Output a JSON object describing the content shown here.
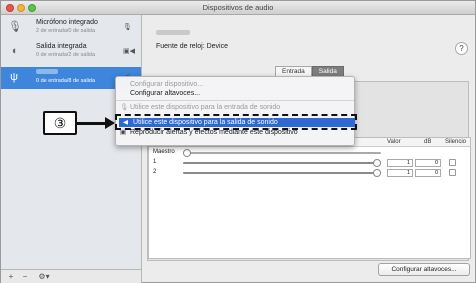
{
  "window": {
    "title": "Dispositivos de audio"
  },
  "sidebar": {
    "devices": [
      {
        "name": "Micrófono integrado",
        "detail": "2 de entrada/0 de salida",
        "icon": "microphone-icon",
        "right_icon": "microphone-small-icon",
        "right_glyph": "🎙",
        "glyph": "🎙"
      },
      {
        "name": "Salida integrada",
        "detail": "0 de entrada/2 de salida",
        "icon": "speaker-icon",
        "right_icon": "speaker-volume-icon",
        "right_glyph": "▣◀",
        "glyph": "◖"
      },
      {
        "name": "",
        "detail": "0 de entrada/8 de salida",
        "icon": "usb-icon",
        "right_icon": "speaker-output-icon",
        "right_glyph": "◀)",
        "glyph": "ψ",
        "selected": true
      }
    ],
    "bottom": {
      "add": "+",
      "remove": "−",
      "settings": "⚙▾"
    }
  },
  "main": {
    "clock_source": "Fuente de reloj: Device",
    "help": "?",
    "tabs": [
      {
        "label": "Entrada",
        "active": false
      },
      {
        "label": "Salida",
        "active": true
      }
    ],
    "table": {
      "headers": {
        "value": "Valor",
        "db": "dB",
        "mute": "Silencio"
      },
      "rows": [
        {
          "label": "Maestro",
          "has_slider": true,
          "has_value": false,
          "fill": 0.0
        },
        {
          "label": "1",
          "has_slider": true,
          "has_value": true,
          "value": "1",
          "db": "0",
          "fill": 1.0
        },
        {
          "label": "2",
          "has_slider": true,
          "has_value": true,
          "value": "1",
          "db": "0",
          "fill": 1.0
        }
      ]
    },
    "configure_speakers_button": "Configurar altavoces..."
  },
  "context_menu": {
    "items": [
      {
        "label": "Configurar dispositivo...",
        "disabled": true,
        "icon": ""
      },
      {
        "label": "Configurar altavoces...",
        "disabled": false,
        "icon": ""
      },
      {
        "label": "Utilice este dispositivo para la entrada de sonido",
        "disabled": true,
        "icon": "🎙"
      },
      {
        "label": "Utilice este dispositivo para la salida de sonido",
        "disabled": false,
        "highlighted": true,
        "icon": "◀"
      },
      {
        "label": "Reproducir alertas y efectos mediante este dispositivo",
        "disabled": false,
        "icon": "▣"
      }
    ]
  },
  "annotation": {
    "callout_number": "③"
  },
  "colors": {
    "selection": "#3d86db",
    "menu_highlight": "#2e69d3",
    "close": "#e8554b",
    "minimize": "#f2b33d",
    "zoom": "#5ec24f"
  }
}
